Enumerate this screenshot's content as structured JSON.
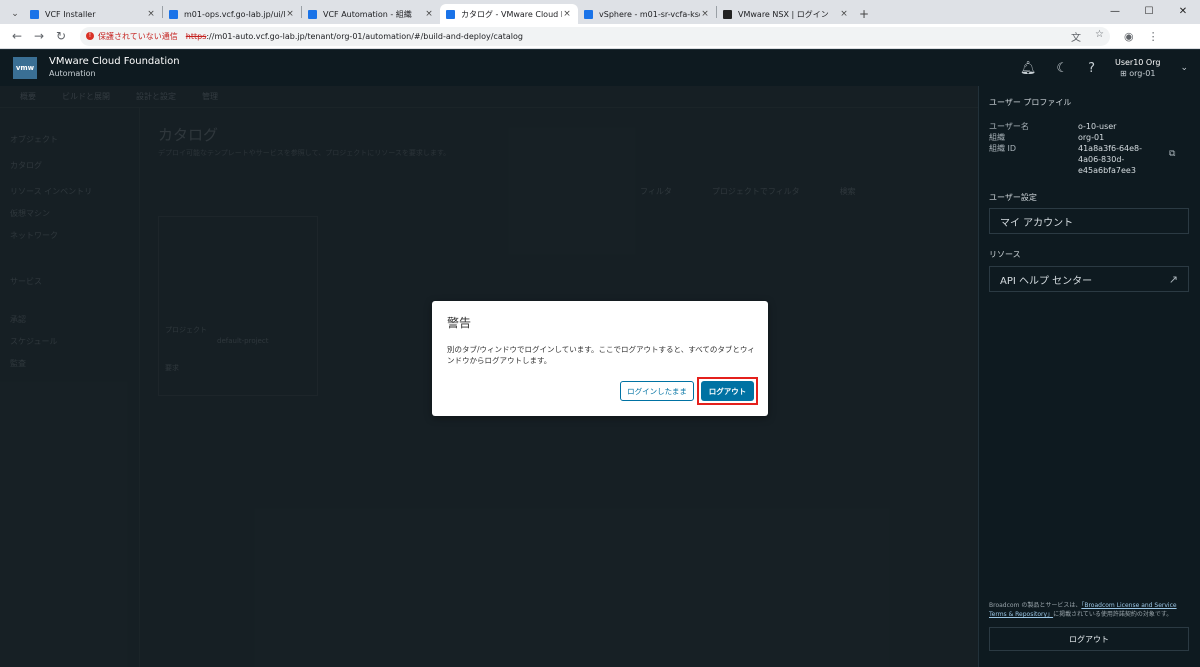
{
  "browser": {
    "tabs": [
      {
        "title": "VCF Installer",
        "color": "#1a73e8",
        "active": false
      },
      {
        "title": "m01-ops.vcf.go-lab.jp/ui/login.a",
        "color": "#1a73e8",
        "active": false
      },
      {
        "title": "VCF Automation - 組織",
        "color": "#1a73e8",
        "active": false
      },
      {
        "title": "カタログ - VMware Cloud Founda",
        "color": "#1a73e8",
        "active": true
      },
      {
        "title": "vSphere - m01-sr-vcfa-ksdw4 -",
        "color": "#1a73e8",
        "active": false
      },
      {
        "title": "VMware NSX | ログイン",
        "color": "#222222",
        "active": false
      }
    ],
    "insecure_label": "保護されていない通信",
    "url_scheme": "https",
    "url_rest": "://m01-auto.vcf.go-lab.jp/tenant/org-01/automation/#/build-and-deploy/catalog"
  },
  "header": {
    "logo": "vmw",
    "brand_name": "VMware Cloud Foundation",
    "brand_sub": "Automation",
    "user_name": "User10 Org",
    "user_org": "org-01"
  },
  "background": {
    "subnav": [
      "概要",
      "ビルドと展開",
      "設計と設定",
      "管理"
    ],
    "leftnav": [
      "オブジェクト",
      "カタログ",
      "リソース インベントリ",
      "仮想マシン",
      "ネットワーク",
      "サービス",
      "承認",
      "スケジュール",
      "監査"
    ],
    "page_title": "カタログ",
    "page_desc": "デプロイ可能なテンプレートやサービスを参照して、プロジェクトにリソースを要求します。",
    "toolbar": [
      "フィルタ",
      "プロジェクトでフィルタ",
      "検索"
    ],
    "card_project_label": "プロジェクト",
    "card_project_value": "default-project",
    "card_request": "要求"
  },
  "profile": {
    "section_title": "ユーザー プロファイル",
    "username_label": "ユーザー名",
    "username_value": "o-10-user",
    "org_label": "組織",
    "org_value": "org-01",
    "orgid_label": "組織 ID",
    "orgid_value": [
      "41a8a3f6-64e8-",
      "4a06-830d-",
      "e45a6bfa7ee3"
    ],
    "settings_title": "ユーザー設定",
    "my_account": "マイ アカウント",
    "resources_title": "リソース",
    "api_help": "API ヘルプ センター",
    "legal_prefix": "Broadcom の製品とサービスは、",
    "legal_link": "「Broadcom License and Service Terms & Repository」",
    "legal_suffix": "に掲載されている使用許諾契約の対象です。",
    "logout": "ログアウト"
  },
  "modal": {
    "title": "警告",
    "message": "別のタブ/ウィンドウでログインしています。ここでログアウトすると、すべてのタブとウィンドウからログアウトします。",
    "stay_button": "ログインしたまま",
    "logout_button": "ログアウト"
  }
}
